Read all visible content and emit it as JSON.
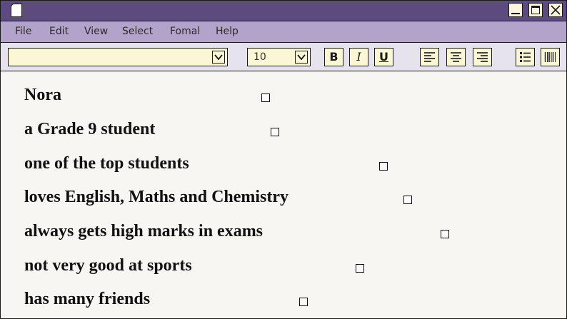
{
  "menu": [
    "File",
    "Edit",
    "View",
    "Select",
    "Fomal",
    "Help"
  ],
  "toolbar": {
    "font_value": "",
    "size_value": "10",
    "bold_label": "B",
    "italic_label": "I",
    "underline_label": "U",
    "icons": [
      "align-left-icon",
      "align-center-icon",
      "align-right-icon",
      "bullet-list-icon",
      "barcode-icon"
    ]
  },
  "colors": {
    "titlebar": "#5d4a7e",
    "menubar": "#b3a3cb",
    "toolbar": "#e6e2ee",
    "field": "#fbf7d6",
    "page": "#f7f6f3"
  },
  "document": {
    "lines": [
      "Nora",
      "a Grade 9 student",
      "one of the top students",
      "loves English, Maths and Chemistry",
      "always gets high marks in exams",
      "not very good at sports",
      "has many friends"
    ]
  }
}
